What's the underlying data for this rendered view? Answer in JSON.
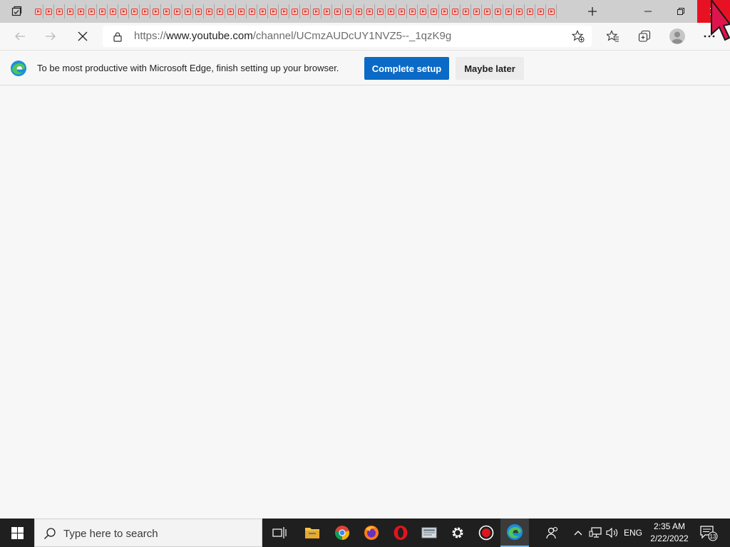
{
  "browser": {
    "tab_count": 49,
    "url": {
      "scheme": "https://",
      "host": "www.youtube.com",
      "path": "/channel/UCmzAUDcUY1NVZ5--_1qzK9g"
    }
  },
  "infobar": {
    "message": "To be most productive with Microsoft Edge, finish setting up your browser.",
    "complete_label": "Complete setup",
    "later_label": "Maybe later"
  },
  "taskbar": {
    "search_placeholder": "Type here to search",
    "language": "ENG",
    "time": "2:35 AM",
    "date": "2/22/2022",
    "notification_count": "13"
  },
  "colors": {
    "close_red": "#e81123",
    "primary_blue": "#0b6ac6",
    "youtube_red": "#e2342b",
    "taskbar": "#1f1f1f"
  },
  "icons": [
    "tab-actions-icon",
    "youtube-favicon-icon",
    "new-tab-icon",
    "minimize-icon",
    "restore-icon",
    "close-icon",
    "back-icon",
    "forward-icon",
    "stop-icon",
    "lock-icon",
    "add-favorite-icon",
    "favorites-icon",
    "collections-icon",
    "profile-icon",
    "more-icon",
    "edge-logo-icon",
    "windows-start-icon",
    "search-icon",
    "task-view-icon",
    "file-explorer-icon",
    "chrome-icon",
    "firefox-icon",
    "opera-icon",
    "app-icon",
    "settings-icon",
    "record-icon",
    "edge-icon",
    "people-icon",
    "chevron-up-icon",
    "network-icon",
    "volume-icon",
    "notification-icon"
  ]
}
